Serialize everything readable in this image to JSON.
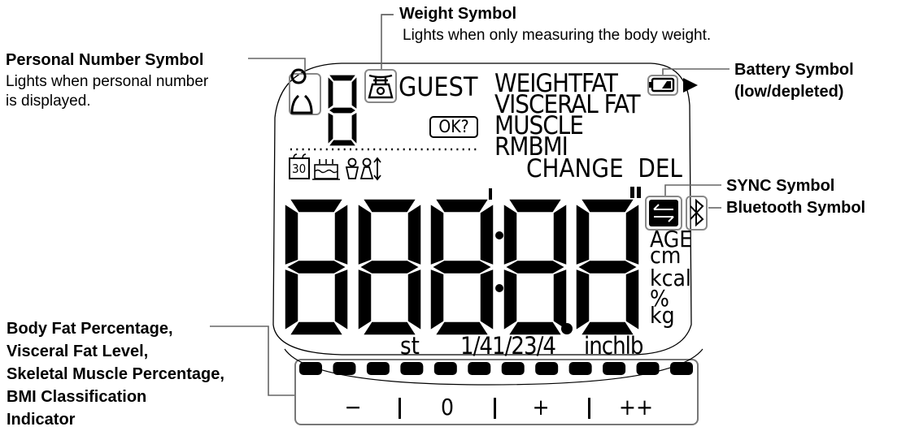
{
  "callouts": {
    "weight": {
      "title": "Weight Symbol",
      "desc": "Lights when only measuring the body weight."
    },
    "personal": {
      "title": "Personal Number Symbol",
      "desc_lines": [
        "Lights when personal number",
        "is displayed."
      ]
    },
    "battery": {
      "title_lines": [
        "Battery Symbol",
        "(low/depleted)"
      ]
    },
    "sync": {
      "title": "SYNC Symbol"
    },
    "bluetooth": {
      "title": "Bluetooth Symbol"
    },
    "indicator": {
      "lines": [
        "Body Fat Percentage,",
        "Visceral Fat Level,",
        "Skeletal Muscle Percentage,",
        "BMI Classification",
        "Indicator"
      ]
    }
  },
  "display": {
    "personal_digit": "8",
    "guest": "GUEST",
    "ok": "OK?",
    "modes": [
      "WEIGHTFAT",
      "VISCERAL FAT",
      "MUSCLE",
      "RMBMI"
    ],
    "change_del": "CHANGE  DEL",
    "calendar_day": "30",
    "main_digits": [
      "8",
      "8",
      "8",
      "8",
      "8"
    ],
    "units_right": [
      "AGE",
      "cm",
      "kcal",
      "%",
      "kg"
    ],
    "units_bottom": {
      "st": "st",
      "fractions": "1/41/23/4",
      "inchlb": "inchlb"
    },
    "indicator_segments": 12,
    "scale_labels": [
      "−",
      "0",
      "+",
      "++"
    ]
  }
}
